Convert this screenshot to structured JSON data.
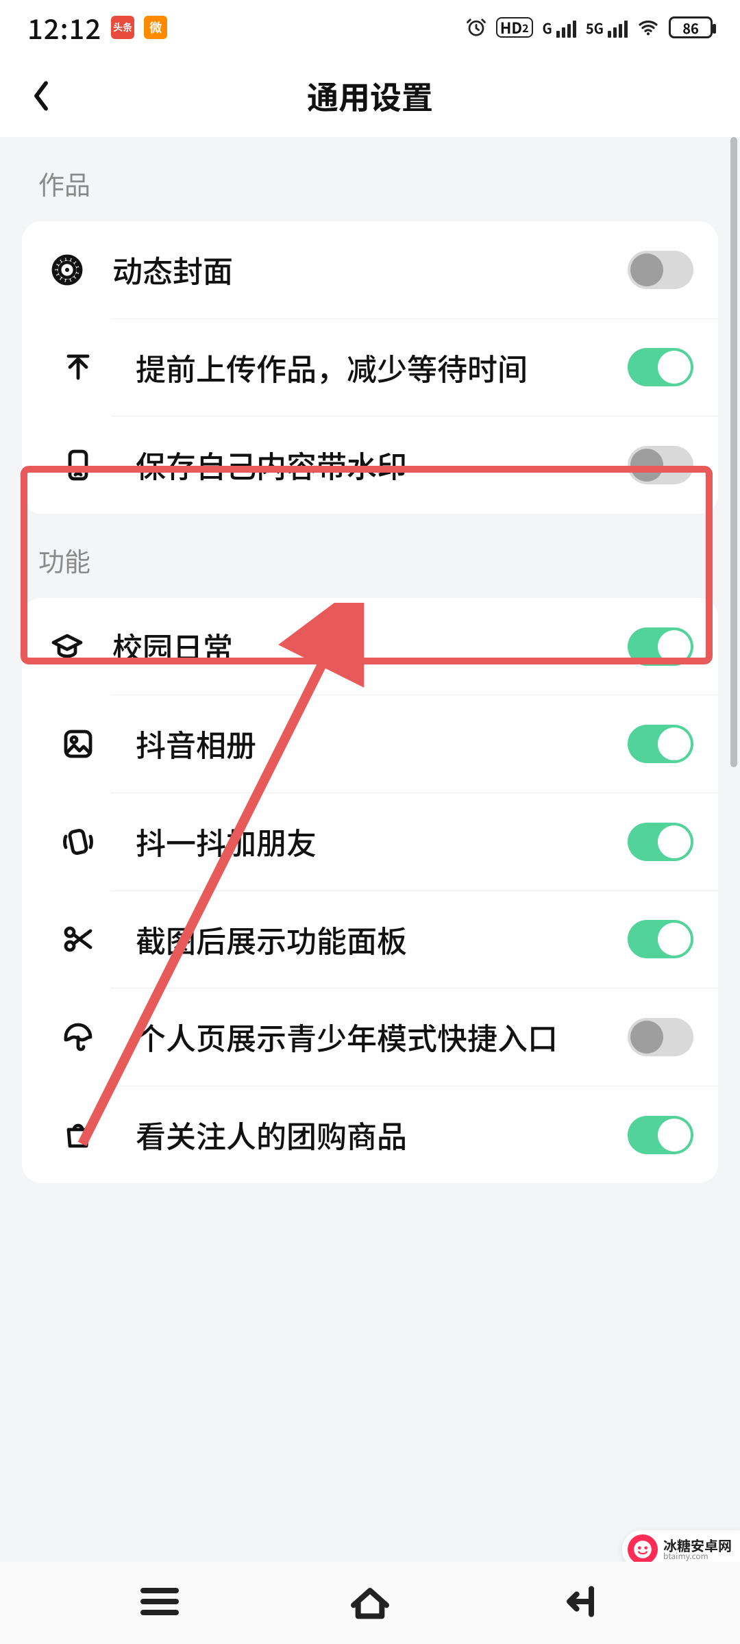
{
  "status": {
    "time": "12:12",
    "badge1": "头条",
    "badge2": "微",
    "hd_label": "HD",
    "hd_sub": "2",
    "signal1_label": "G",
    "signal2_label": "5G",
    "battery_pct": "86"
  },
  "header": {
    "title": "通用设置"
  },
  "sections": {
    "works": {
      "label": "作品",
      "items": [
        {
          "icon": "target",
          "label": "动态封面",
          "on": false
        },
        {
          "icon": "upload",
          "label": "提前上传作品，减少等待时间",
          "on": true
        },
        {
          "icon": "phone",
          "label": "保存自己内容带水印",
          "on": false
        }
      ]
    },
    "features": {
      "label": "功能",
      "items": [
        {
          "icon": "grad-cap",
          "label": "校园日常",
          "on": true
        },
        {
          "icon": "image",
          "label": "抖音相册",
          "on": true
        },
        {
          "icon": "shake",
          "label": "抖一抖加朋友",
          "on": true
        },
        {
          "icon": "scissors",
          "label": "截图后展示功能面板",
          "on": true
        },
        {
          "icon": "umbrella",
          "label": "个人页展示青少年模式快捷入口",
          "on": false
        },
        {
          "icon": "bag",
          "label": "看关注人的团购商品",
          "on": true
        }
      ]
    }
  },
  "watermark": {
    "cn": "冰糖安卓网",
    "en": "btaimy.com"
  }
}
